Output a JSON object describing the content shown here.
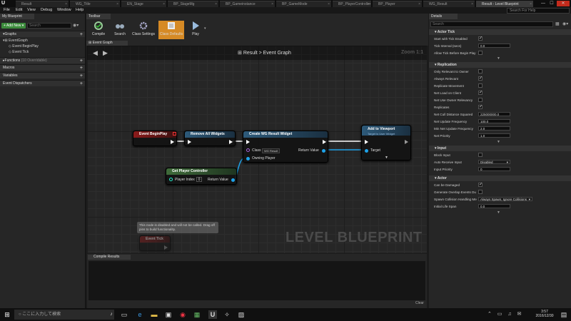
{
  "tabs": [
    {
      "label": "Result",
      "active": false
    },
    {
      "label": "WG_Title",
      "active": false
    },
    {
      "label": "EN_Stage",
      "active": false
    },
    {
      "label": "BP_StageMg",
      "active": false
    },
    {
      "label": "BP_Gameinstance",
      "active": false
    },
    {
      "label": "BP_GameMode",
      "active": false
    },
    {
      "label": "BP_PlayerController",
      "active": false
    },
    {
      "label": "BP_Player",
      "active": false
    },
    {
      "label": "WG_Result",
      "active": false
    },
    {
      "label": "Result - Level Blueprint",
      "active": true
    }
  ],
  "menu": [
    "File",
    "Edit",
    "View",
    "Debug",
    "Window",
    "Help"
  ],
  "search_help": {
    "placeholder": "Search For Help"
  },
  "my_blueprint": {
    "tab": "My Blueprint",
    "add_new": "Add New",
    "search_placeholder": "Search",
    "graphs_label": "Graphs",
    "event_graph": "EventGraph",
    "events": [
      "Event BeginPlay",
      "Event Tick"
    ],
    "functions_label": "Functions",
    "functions_count": "(10 Overridable)",
    "macros_label": "Macros",
    "variables_label": "Variables",
    "dispatchers_label": "Event Dispatchers"
  },
  "toolbar": {
    "tab": "Toolbar",
    "buttons": [
      "Compile",
      "Search",
      "Class Settings",
      "Class Defaults",
      "Play"
    ]
  },
  "graph": {
    "tab": "Event Graph",
    "breadcrumb_root": "Result",
    "breadcrumb_leaf": "Event Graph",
    "zoom": "Zoom 1:1",
    "watermark": "LEVEL BLUEPRINT",
    "nodes": {
      "begin_play": "Event BeginPlay",
      "remove_widgets": "Remove All Widgets",
      "create_widget": "Create WG Result Widget",
      "create_class_label": "Class",
      "create_class_value": "WG Result",
      "create_owning": "Owning Player",
      "create_return": "Return Value",
      "add_viewport": "Add to Viewport",
      "add_viewport_sub": "Target is User Widget",
      "add_target": "Target",
      "get_pc": "Get Player Controller",
      "player_index_label": "Player Index",
      "player_index_value": "0",
      "get_pc_return": "Return Value",
      "disabled_comment": "This node is disabled and will not be called. Drag off pins to build functionality.",
      "event_tick": "Event Tick"
    }
  },
  "compile": {
    "tab": "Compile Results",
    "clear": "Clear"
  },
  "details": {
    "tab": "Details",
    "search_placeholder": "Search",
    "actor_tick": "Actor Tick",
    "start_tick": "Start with Tick Enabled",
    "tick_interval": "Tick Interval (secs)",
    "tick_interval_val": "0.0",
    "allow_tick": "Allow Tick Before Begin Play",
    "replication": "Replication",
    "only_relevant": "Only Relevant to Owner",
    "always_relevant": "Always Relevant",
    "replicate_movement": "Replicate Movement",
    "net_load": "Net Load on Client",
    "net_owner": "Net Use Owner Relevancy",
    "replicates": "Replicates",
    "net_cull": "Net Cull Distance Squared",
    "net_cull_val": "225000000.0",
    "net_update": "Net Update Frequency",
    "net_update_val": "100.0",
    "min_net_update": "Min Net Update Frequency",
    "min_net_update_val": "2.0",
    "net_priority": "Net Priority",
    "net_priority_val": "1.0",
    "input": "Input",
    "block_input": "Block Input",
    "auto_receive": "Auto Receive Input",
    "auto_receive_val": "Disabled",
    "input_priority": "Input Priority",
    "input_priority_val": "0",
    "actor": "Actor",
    "can_damaged": "Can be Damaged",
    "gen_overlap": "Generate Overlap Events Du",
    "spawn_collision": "Spawn Collision Handling Me",
    "spawn_collision_val": "Always Spawn, Ignore Collisions",
    "initial_life": "Initial Life Span",
    "initial_life_val": "0.0"
  },
  "taskbar": {
    "search_placeholder": "ここに入力して検索",
    "time": "3:57",
    "date": "2016/12/30"
  }
}
